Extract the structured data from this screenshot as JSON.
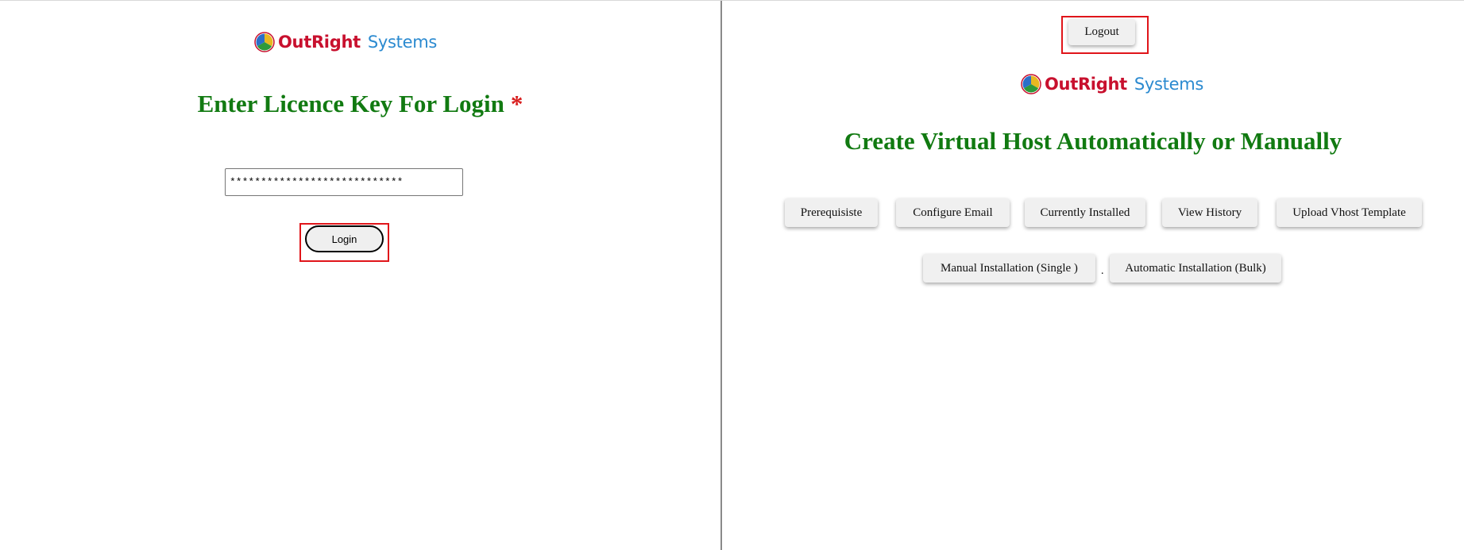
{
  "brand": {
    "word1": "OutRight",
    "word2": "Systems",
    "colors": {
      "red": "#c8102e",
      "blue": "#2b8ad0"
    }
  },
  "login_panel": {
    "heading": "Enter Licence Key For Login",
    "required_mark": "*",
    "licence_value": "****************************",
    "login_label": "Login"
  },
  "dashboard_panel": {
    "logout_label": "Logout",
    "heading": "Create Virtual Host Automatically or Manually",
    "buttons_row1": [
      "Prerequisiste",
      "Configure Email",
      "Currently Installed",
      "View History",
      "Upload Vhost Template"
    ],
    "buttons_row2": [
      "Manual Installation (Single )",
      "Automatic Installation (Bulk)"
    ],
    "separator": "."
  },
  "theme": {
    "heading_green": "#117a11",
    "highlight_red": "#e0151a"
  }
}
